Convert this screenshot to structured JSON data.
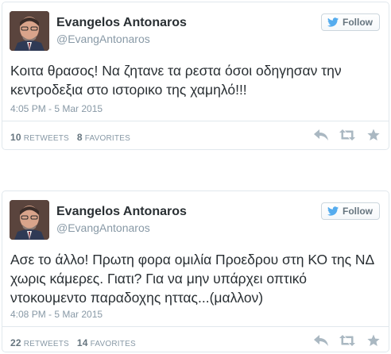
{
  "tweets": [
    {
      "author_name": "Evangelos Antonaros",
      "author_handle": "@EvangAntonaros",
      "follow_label": "Follow",
      "text": "Κοιτα θρασος! Να ζητανε τα ρεστα όσοι οδηγησαν  την κεντροδεξια στο ιστορικο της χαμηλό!!!",
      "timestamp": "4:05 PM - 5 Mar 2015",
      "retweets": "10",
      "retweets_label": "RETWEETS",
      "favorites": "8",
      "favorites_label": "FAVORITES"
    },
    {
      "author_name": "Evangelos Antonaros",
      "author_handle": "@EvangAntonaros",
      "follow_label": "Follow",
      "text": "Ασε το άλλο! Πρωτη φορα ομιλία Προεδρου στη ΚΟ της ΝΔ χωρις κάμερες. Γιατι? Για να μην υπάρχει οπτικό ντοκουμεντο παραδοχης ηττας...(μαλλον)",
      "timestamp": "4:08 PM - 5 Mar 2015",
      "retweets": "22",
      "retweets_label": "RETWEETS",
      "favorites": "14",
      "favorites_label": "FAVORITES"
    }
  ],
  "icons": {
    "follow": "twitter-bird-icon",
    "reply": "reply-icon",
    "retweet": "retweet-icon",
    "favorite": "star-icon"
  },
  "colors": {
    "follow_bird": "#55acee",
    "action_icon": "#aab8c2",
    "muted_text": "#8899a6"
  }
}
